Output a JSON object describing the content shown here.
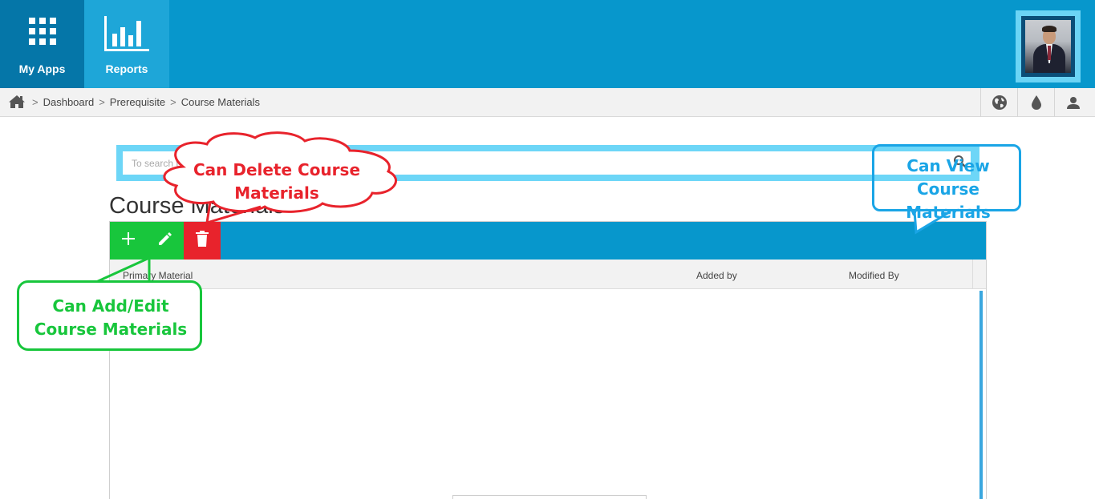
{
  "header": {
    "nav": [
      {
        "label": "My Apps",
        "icon": "grid-apps-icon"
      },
      {
        "label": "Reports",
        "icon": "bar-chart-icon"
      }
    ],
    "avatar_icon": "user-photo"
  },
  "breadcrumb": {
    "home_icon": "home-icon",
    "separator": ">",
    "items": [
      "Dashboard",
      "Prerequisite",
      "Course Materials"
    ]
  },
  "top_right_icons": [
    "globe-icon",
    "drop-icon",
    "user-icon"
  ],
  "search": {
    "placeholder": "To search type and hit enter",
    "icon": "search-icon"
  },
  "page": {
    "title": "Course Materials"
  },
  "grid": {
    "toolbar": {
      "buttons": [
        {
          "name": "add",
          "icon": "plus-icon",
          "color": "#18c63c"
        },
        {
          "name": "edit",
          "icon": "pencil-icon",
          "color": "#18c63c"
        },
        {
          "name": "delete",
          "icon": "trash-icon",
          "color": "#e8232c"
        }
      ],
      "color": "#0797cc"
    },
    "columns": [
      "Primary Material",
      "Added by",
      "Modified By"
    ],
    "rows": []
  },
  "annotations": {
    "delete": {
      "line1": "Can Delete Course",
      "line2": "Materials",
      "color": "#e8232c"
    },
    "add_edit": {
      "line1": "Can Add/Edit",
      "line2": "Course Materials",
      "color": "#18c63c"
    },
    "view": {
      "line1": "Can View Course",
      "line2": "Materials",
      "color": "#1aa5e6"
    }
  },
  "colors": {
    "header_bg": "#0797cc",
    "my_apps_bg": "#0576a8",
    "reports_bg": "#1ea6d8"
  }
}
